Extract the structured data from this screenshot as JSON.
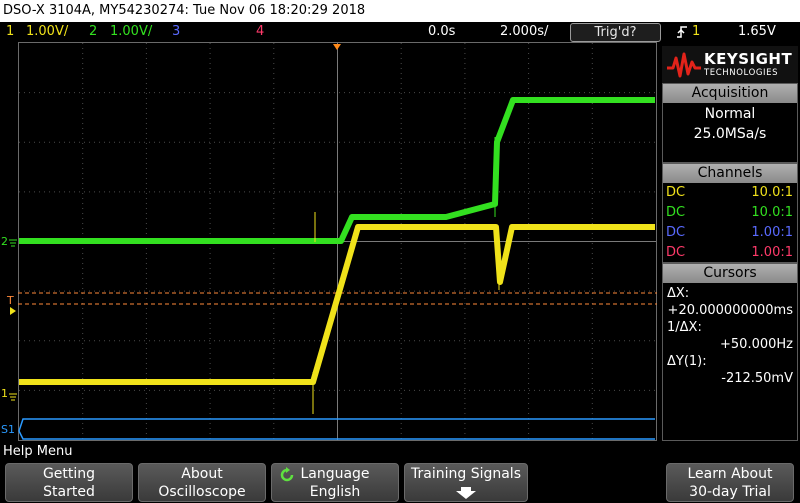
{
  "title_bar": {
    "text": "DSO-X 3104A, MY54230274: Tue Nov 06 18:20:29 2018"
  },
  "status_bar": {
    "ch1": {
      "num": "1",
      "scale": "1.00V/",
      "color": "#f0e21a"
    },
    "ch2": {
      "num": "2",
      "scale": "1.00V/",
      "color": "#33e020"
    },
    "ch3": {
      "num": "3",
      "color": "#5a6aff"
    },
    "ch4": {
      "num": "4",
      "color": "#ff3a6a"
    },
    "delay": "0.0s",
    "timebase": "2.000s/",
    "trigger_status": "Trig'd?",
    "trigger_source": "1",
    "trigger_level": "1.65V"
  },
  "brand": {
    "name": "KEYSIGHT",
    "sub": "TECHNOLOGIES"
  },
  "acquisition": {
    "header": "Acquisition",
    "mode": "Normal",
    "rate": "25.0MSa/s"
  },
  "channels": {
    "header": "Channels",
    "rows": [
      {
        "coupling": "DC",
        "probe": "10.0:1",
        "color": "#f0e21a"
      },
      {
        "coupling": "DC",
        "probe": "10.0:1",
        "color": "#33e020"
      },
      {
        "coupling": "DC",
        "probe": "1.00:1",
        "color": "#5a6aff"
      },
      {
        "coupling": "DC",
        "probe": "1.00:1",
        "color": "#ff3a6a"
      }
    ]
  },
  "cursors": {
    "header": "Cursors",
    "dx_label": "ΔX:",
    "dx_value": "+20.000000000ms",
    "inv_dx_label": "1/ΔX:",
    "inv_dx_value": "+50.000Hz",
    "dy_label": "ΔY(1):",
    "dy_value": "-212.50mV"
  },
  "markers": {
    "ch1": "1",
    "ch2": "2",
    "trigger": "T",
    "serial": "S1"
  },
  "help_menu": {
    "label": "Help Menu"
  },
  "softkeys": [
    {
      "line1": "Getting",
      "line2": "Started"
    },
    {
      "line1": "About",
      "line2": "Oscilloscope"
    },
    {
      "line1": "Language",
      "line2": "English"
    },
    {
      "line1": "Training Signals",
      "line2": ""
    },
    {
      "line1": "Learn About",
      "line2": "30-day Trial"
    }
  ]
}
